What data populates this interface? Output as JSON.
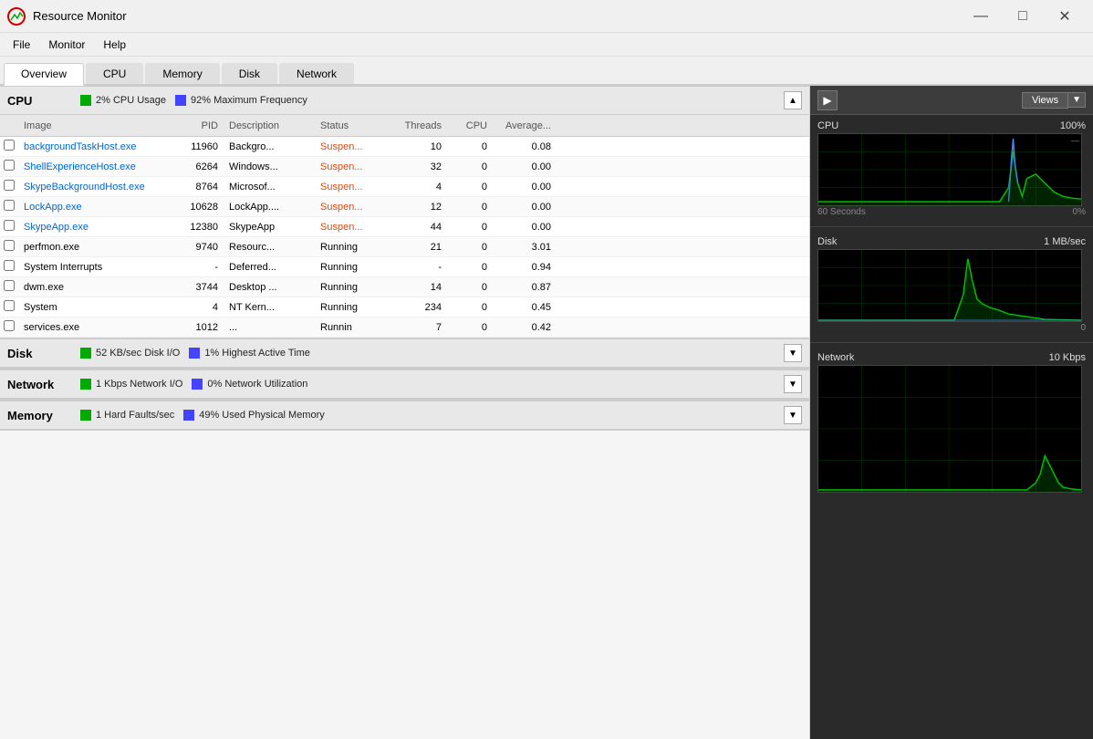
{
  "titleBar": {
    "title": "Resource Monitor",
    "iconSymbol": "📊",
    "minimize": "—",
    "maximize": "□",
    "close": "✕"
  },
  "menuBar": {
    "items": [
      "File",
      "Monitor",
      "Help"
    ]
  },
  "tabs": {
    "items": [
      "Overview",
      "CPU",
      "Memory",
      "Disk",
      "Network"
    ],
    "active": "Overview"
  },
  "cpu": {
    "sectionTitle": "CPU",
    "stat1": "2% CPU Usage",
    "stat2": "92% Maximum Frequency",
    "columns": {
      "image": "Image",
      "pid": "PID",
      "description": "Description",
      "status": "Status",
      "threads": "Threads",
      "cpu": "CPU",
      "average": "Average..."
    },
    "rows": [
      {
        "image": "backgroundTaskHost.exe",
        "pid": "11960",
        "description": "Backgro...",
        "status": "Suspen...",
        "threads": "10",
        "cpu": "0",
        "average": "0.08",
        "isBlue": true,
        "isSuspended": true
      },
      {
        "image": "ShellExperienceHost.exe",
        "pid": "6264",
        "description": "Windows...",
        "status": "Suspen...",
        "threads": "32",
        "cpu": "0",
        "average": "0.00",
        "isBlue": true,
        "isSuspended": true
      },
      {
        "image": "SkypeBackgroundHost.exe",
        "pid": "8764",
        "description": "Microsof...",
        "status": "Suspen...",
        "threads": "4",
        "cpu": "0",
        "average": "0.00",
        "isBlue": true,
        "isSuspended": true
      },
      {
        "image": "LockApp.exe",
        "pid": "10628",
        "description": "LockApp....",
        "status": "Suspen...",
        "threads": "12",
        "cpu": "0",
        "average": "0.00",
        "isBlue": true,
        "isSuspended": true
      },
      {
        "image": "SkypeApp.exe",
        "pid": "12380",
        "description": "SkypeApp",
        "status": "Suspen...",
        "threads": "44",
        "cpu": "0",
        "average": "0.00",
        "isBlue": true,
        "isSuspended": true
      },
      {
        "image": "perfmon.exe",
        "pid": "9740",
        "description": "Resourc...",
        "status": "Running",
        "threads": "21",
        "cpu": "0",
        "average": "3.01",
        "isBlue": false,
        "isSuspended": false
      },
      {
        "image": "System Interrupts",
        "pid": "-",
        "description": "Deferred...",
        "status": "Running",
        "threads": "-",
        "cpu": "0",
        "average": "0.94",
        "isBlue": false,
        "isSuspended": false
      },
      {
        "image": "dwm.exe",
        "pid": "3744",
        "description": "Desktop ...",
        "status": "Running",
        "threads": "14",
        "cpu": "0",
        "average": "0.87",
        "isBlue": false,
        "isSuspended": false
      },
      {
        "image": "System",
        "pid": "4",
        "description": "NT Kern...",
        "status": "Running",
        "threads": "234",
        "cpu": "0",
        "average": "0.45",
        "isBlue": false,
        "isSuspended": false
      },
      {
        "image": "services.exe",
        "pid": "1012",
        "description": "...",
        "status": "Runnin",
        "threads": "7",
        "cpu": "0",
        "average": "0.42",
        "isBlue": false,
        "isSuspended": false
      }
    ]
  },
  "disk": {
    "sectionTitle": "Disk",
    "stat1": "52 KB/sec Disk I/O",
    "stat2": "1% Highest Active Time"
  },
  "network": {
    "sectionTitle": "Network",
    "stat1": "1 Kbps Network I/O",
    "stat2": "0% Network Utilization"
  },
  "memory": {
    "sectionTitle": "Memory",
    "stat1": "1 Hard Faults/sec",
    "stat2": "49% Used Physical Memory"
  },
  "rightPanel": {
    "views": "Views",
    "graphs": [
      {
        "title": "CPU",
        "value": "100%",
        "footer_left": "60 Seconds",
        "footer_right": "0%",
        "color": "#00cc00",
        "peakColor": "#4488ff",
        "type": "cpu"
      },
      {
        "title": "Disk",
        "value": "1 MB/sec",
        "footer_right": "0",
        "color": "#00cc00",
        "type": "disk"
      },
      {
        "title": "Network",
        "value": "10 Kbps",
        "color": "#00cc00",
        "type": "network"
      }
    ]
  }
}
